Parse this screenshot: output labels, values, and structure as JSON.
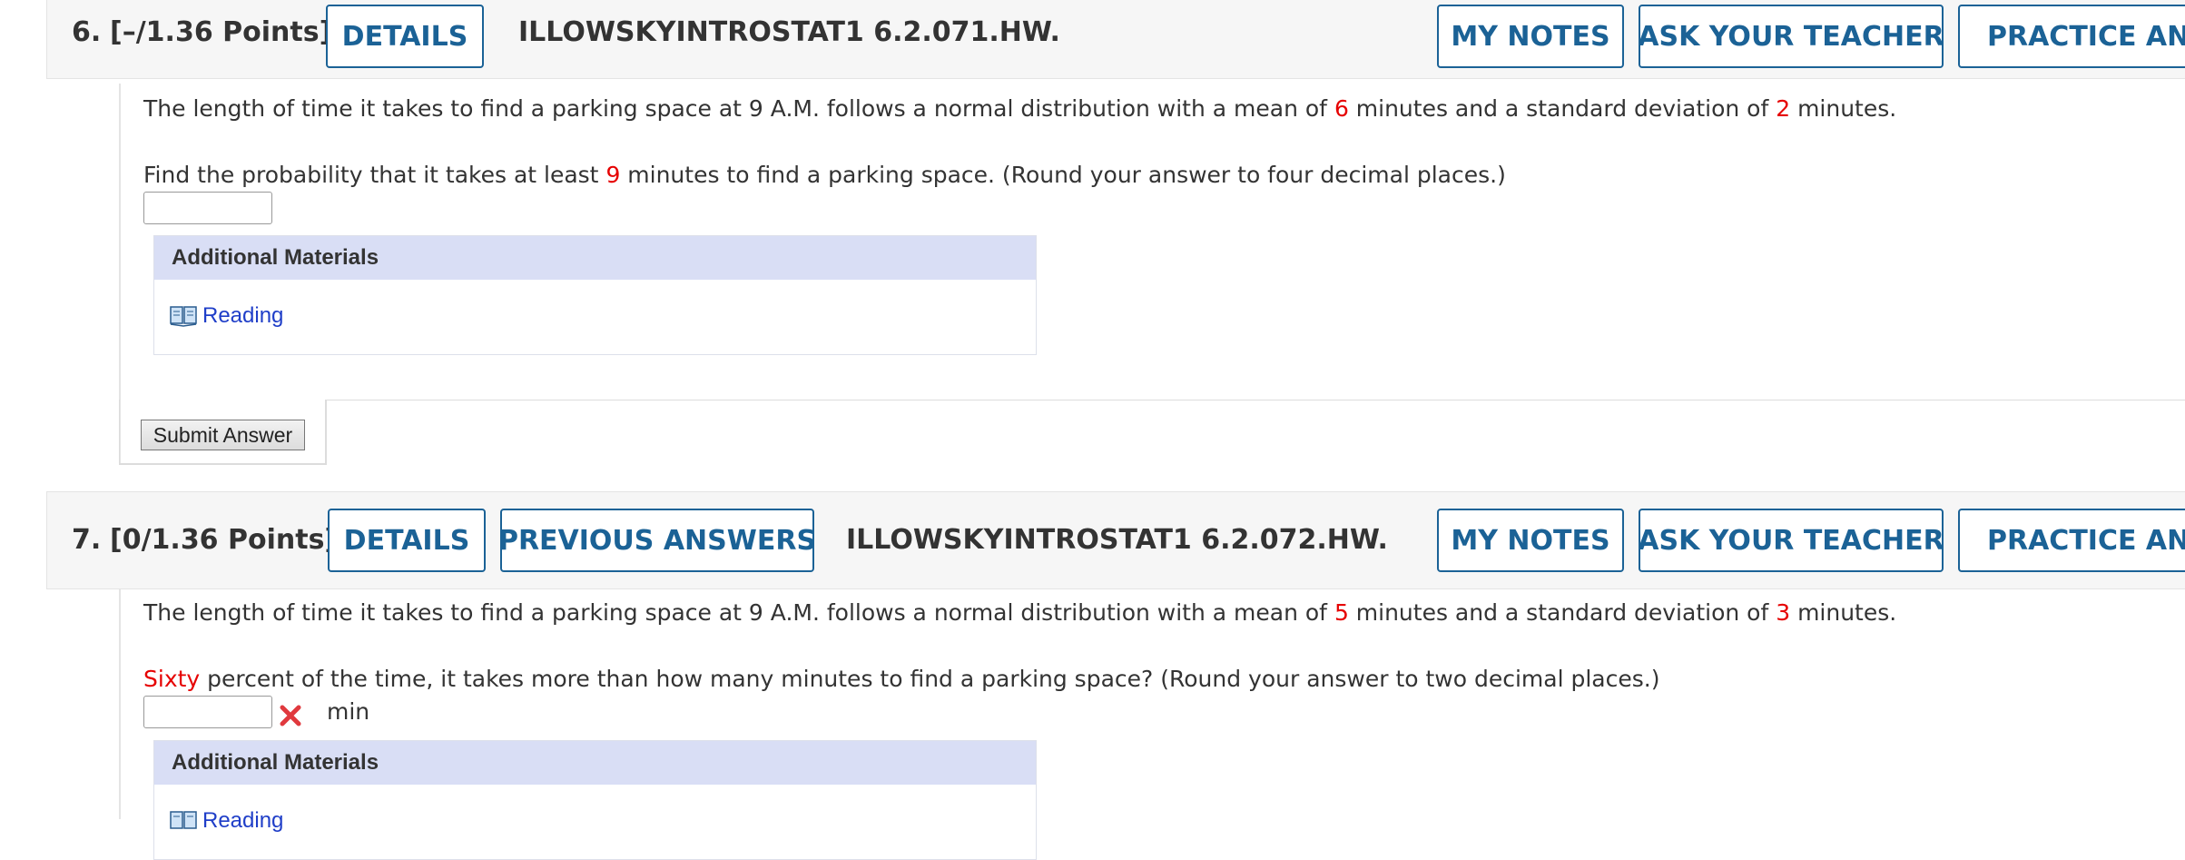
{
  "q6": {
    "number": "6.",
    "points": "[–/1.36 Points]",
    "details_label": "DETAILS",
    "code": "ILLOWSKYINTROSTAT1 6.2.071.HW.",
    "my_notes_label": "MY NOTES",
    "ask_teacher_label": "ASK YOUR TEACHER",
    "practice_label": "PRACTICE ANOTHER",
    "stem": {
      "t1": "The length of time it takes to find a parking space at 9 A.M. follows a normal distribution with a mean of ",
      "mean": "6",
      "t2": " minutes and a standard deviation of ",
      "sd": "2",
      "t3": " minutes."
    },
    "question": {
      "t1": "Find the probability that it takes at least ",
      "value": "9",
      "t2": " minutes to find a parking space. (Round your answer to four decimal places.)"
    },
    "answer_value": "",
    "additional_materials": "Additional Materials",
    "reading_link": "Reading",
    "submit_label": "Submit Answer"
  },
  "q7": {
    "number": "7.",
    "points": "[0/1.36 Points]",
    "details_label": "DETAILS",
    "previous_answers_label": "PREVIOUS ANSWERS",
    "code": "ILLOWSKYINTROSTAT1 6.2.072.HW.",
    "my_notes_label": "MY NOTES",
    "ask_teacher_label": "ASK YOUR TEACHER",
    "practice_label": "PRACTICE ANOTHER",
    "stem": {
      "t1": "The length of time it takes to find a parking space at 9 A.M. follows a normal distribution with a mean of ",
      "mean": "5",
      "t2": " minutes and a standard deviation of ",
      "sd": "3",
      "t3": " minutes."
    },
    "question": {
      "value": "Sixty",
      "t2": " percent of the time, it takes more than how many minutes to find a parking space? (Round your answer to two decimal places.)"
    },
    "answer_value": "",
    "unit": "min",
    "additional_materials": "Additional Materials",
    "reading_link": "Reading"
  },
  "colors": {
    "accent": "#1b6296",
    "highlight_red": "#e60000",
    "link_blue": "#1f3ec8",
    "materials_header": "#d9def5"
  },
  "icons": {
    "book": "book-icon",
    "incorrect": "close-x-icon"
  }
}
